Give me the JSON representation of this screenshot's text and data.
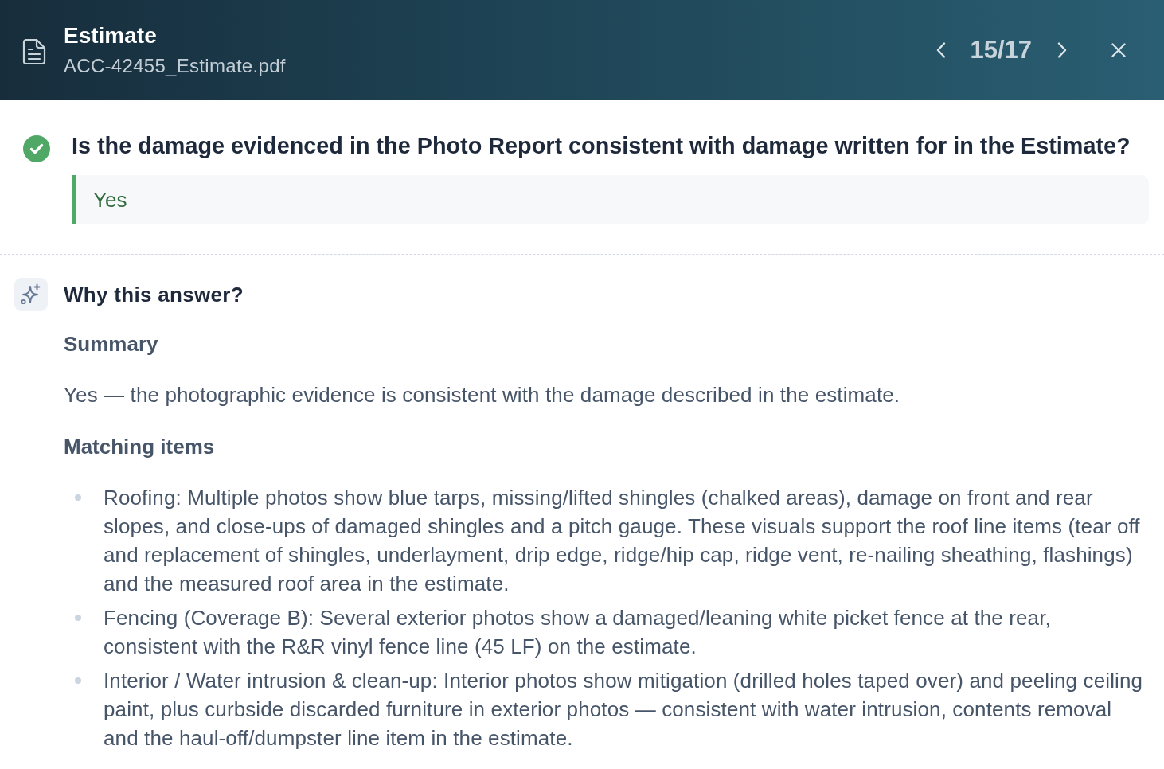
{
  "header": {
    "title": "Estimate",
    "file_name": "ACC-42455_Estimate.pdf",
    "pager": "15/17"
  },
  "question": {
    "text": "Is the damage evidenced in the Photo Report consistent with damage written for in the Estimate?",
    "passed": true,
    "answer": "Yes"
  },
  "explanation": {
    "title": "Why this answer?",
    "blocks": [
      {
        "kind": "heading",
        "text": "Summary"
      },
      {
        "kind": "paragraph",
        "text": "Yes — the photographic evidence is consistent with the damage described in the estimate."
      },
      {
        "kind": "heading",
        "text": "Matching items"
      },
      {
        "kind": "list",
        "items": [
          "Roofing: Multiple photos show blue tarps, missing/lifted shingles (chalked areas), damage on front and rear slopes, and close-ups of damaged shingles and a pitch gauge. These visuals support the roof line items (tear off and replacement of shingles, underlayment, drip edge, ridge/hip cap, ridge vent, re-nailing sheathing, flashings) and the measured roof area in the estimate.",
          "Fencing (Coverage B): Several exterior photos show a damaged/leaning white picket fence at the rear, consistent with the R&R vinyl fence line (45 LF) on the estimate.",
          "Interior / Water intrusion & clean-up: Interior photos show mitigation (drilled holes taped over) and peeling ceiling paint, plus curbside discarded furniture in exterior photos — consistent with water intrusion, contents removal and the haul-off/dumpster line item in the estimate."
        ]
      }
    ]
  }
}
